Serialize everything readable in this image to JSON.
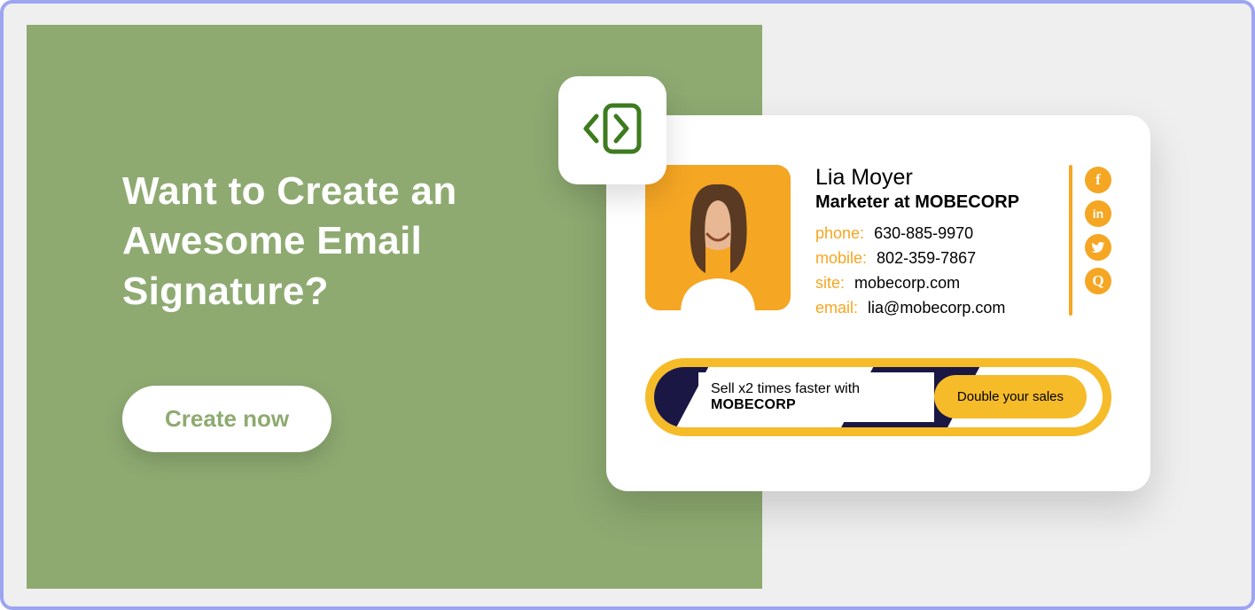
{
  "promo": {
    "headline": "Want to Create an Awesome Email Signature?",
    "cta_label": "Create now"
  },
  "signature": {
    "name": "Lia Moyer",
    "title": "Marketer at MOBECORP",
    "contacts": {
      "phone_label": "phone:",
      "phone_value": "630-885-9970",
      "mobile_label": "mobile:",
      "mobile_value": "802-359-7867",
      "site_label": "site:",
      "site_value": "mobecorp.com",
      "email_label": "email:",
      "email_value": "lia@mobecorp.com"
    },
    "social_icons": [
      "facebook",
      "linkedin",
      "twitter",
      "quora"
    ],
    "banner_text_prefix": "Sell x2 times faster with ",
    "banner_text_company": "MOBECORP",
    "banner_cta": "Double your sales"
  },
  "colors": {
    "accent_green": "#8eaa71",
    "accent_orange": "#f5a623",
    "frame_border": "#9da4f0"
  }
}
